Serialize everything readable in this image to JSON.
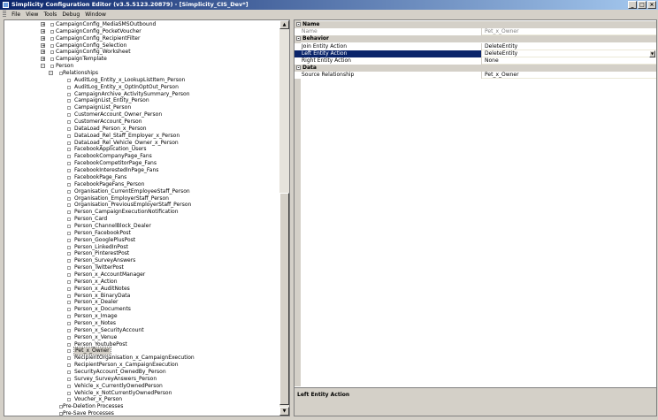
{
  "window": {
    "title": "Simplicity Configuration Editor (v3.5.5123.20879) - [Simplicity_CIS_Dev*]",
    "buttons": [
      "_",
      "□",
      "×"
    ]
  },
  "menu": [
    "File",
    "View",
    "Tools",
    "Debug",
    "Window"
  ],
  "tree": {
    "selected": "Pet_x_Owner",
    "items": [
      {
        "label": "CampaignConfig_MediaSMSOutbound",
        "level": 0,
        "toggle": "+"
      },
      {
        "label": "CampaignConfig_PocketVoucher",
        "level": 0,
        "toggle": "+"
      },
      {
        "label": "CampaignConfig_RecipientFilter",
        "level": 0,
        "toggle": "+"
      },
      {
        "label": "CampaignConfig_Selection",
        "level": 0,
        "toggle": "+"
      },
      {
        "label": "CampaignConfig_Worksheet",
        "level": 0,
        "toggle": "+"
      },
      {
        "label": "CampaignTemplate",
        "level": 0,
        "toggle": "+"
      },
      {
        "label": "Person",
        "level": 0,
        "toggle": "-"
      },
      {
        "label": "Relationships",
        "level": 1,
        "toggle": "-"
      },
      {
        "label": "AuditLog_Entity_x_LookupListItem_Person",
        "level": 2
      },
      {
        "label": "AuditLog_Entity_x_OptInOptOut_Person",
        "level": 2
      },
      {
        "label": "CampaignArchive_ActivitySummary_Person",
        "level": 2
      },
      {
        "label": "CampaignList_Entity_Person",
        "level": 2
      },
      {
        "label": "CampaignList_Person",
        "level": 2
      },
      {
        "label": "CustomerAccount_Owner_Person",
        "level": 2
      },
      {
        "label": "CustomerAccount_Person",
        "level": 2
      },
      {
        "label": "DataLoad_Person_x_Person",
        "level": 2
      },
      {
        "label": "DataLoad_Rel_Staff_Employer_x_Person",
        "level": 2
      },
      {
        "label": "DataLoad_Rel_Vehicle_Owner_x_Person",
        "level": 2
      },
      {
        "label": "FacebookApplication_Users",
        "level": 2
      },
      {
        "label": "FacebookCompanyPage_Fans",
        "level": 2
      },
      {
        "label": "FacebookCompetitorPage_Fans",
        "level": 2
      },
      {
        "label": "FacebookInterestedInPage_Fans",
        "level": 2
      },
      {
        "label": "FacebookPage_Fans",
        "level": 2
      },
      {
        "label": "FacebookPageFans_Person",
        "level": 2
      },
      {
        "label": "Organisation_CurrentEmployeeStaff_Person",
        "level": 2
      },
      {
        "label": "Organisation_EmployerStaff_Person",
        "level": 2
      },
      {
        "label": "Organisation_PreviousEmployerStaff_Person",
        "level": 2
      },
      {
        "label": "Person_CampaignExecutionNotification",
        "level": 2
      },
      {
        "label": "Person_Card",
        "level": 2
      },
      {
        "label": "Person_ChannelBlock_Dealer",
        "level": 2
      },
      {
        "label": "Person_FacebookPost",
        "level": 2
      },
      {
        "label": "Person_GooglePlusPost",
        "level": 2
      },
      {
        "label": "Person_LinkedInPost",
        "level": 2
      },
      {
        "label": "Person_PinterestPost",
        "level": 2
      },
      {
        "label": "Person_SurveyAnswers",
        "level": 2
      },
      {
        "label": "Person_TwitterPost",
        "level": 2
      },
      {
        "label": "Person_x_AccountManager",
        "level": 2
      },
      {
        "label": "Person_x_Action",
        "level": 2
      },
      {
        "label": "Person_x_AuditNotes",
        "level": 2
      },
      {
        "label": "Person_x_BinaryData",
        "level": 2
      },
      {
        "label": "Person_x_Dealer",
        "level": 2
      },
      {
        "label": "Person_x_Documents",
        "level": 2
      },
      {
        "label": "Person_x_Image",
        "level": 2
      },
      {
        "label": "Person_x_Notes",
        "level": 2
      },
      {
        "label": "Person_x_SecurityAccount",
        "level": 2
      },
      {
        "label": "Person_x_Venue",
        "level": 2
      },
      {
        "label": "Person_YoutubePost",
        "level": 2
      },
      {
        "label": "Pet_x_Owner",
        "level": 2
      },
      {
        "label": "RecipientOrganisation_x_CampaignExecution",
        "level": 2
      },
      {
        "label": "RecipientPerson_x_CampaignExecution",
        "level": 2
      },
      {
        "label": "SecurityAccount_OwnedBy_Person",
        "level": 2
      },
      {
        "label": "Survey_SurveyAnswers_Person",
        "level": 2
      },
      {
        "label": "Vehicle_x_CurrentlyOwnedPerson",
        "level": 2
      },
      {
        "label": "Vehicle_x_NotCurrentlyOwnedPerson",
        "level": 2
      },
      {
        "label": "Voucher_x_Person",
        "level": 2
      },
      {
        "label": "Pre-Deletion Processes",
        "level": 1
      },
      {
        "label": "Pre-Save Processes",
        "level": 1
      }
    ]
  },
  "properties": {
    "categories": [
      {
        "name": "Name",
        "rows": [
          {
            "name": "Name",
            "value": "Pet_x_Owner",
            "readonly": true
          }
        ]
      },
      {
        "name": "Behavior",
        "rows": [
          {
            "name": "Join Entity Action",
            "value": "DeleteEntity"
          },
          {
            "name": "Left Entity Action",
            "value": "DeleteEntity",
            "selected": true
          },
          {
            "name": "Right Entity Action",
            "value": "None"
          }
        ]
      },
      {
        "name": "Data",
        "rows": [
          {
            "name": "Source Relationship",
            "value": "Pet_x_Owner"
          }
        ]
      }
    ],
    "description": "Left Entity Action"
  },
  "colors": {
    "title_start": "#0a246a",
    "title_end": "#a6caf0",
    "selection": "#0a246a",
    "chrome": "#d4d0c8"
  },
  "icons": {
    "toggle_expand": "+",
    "toggle_collapse": "-"
  }
}
